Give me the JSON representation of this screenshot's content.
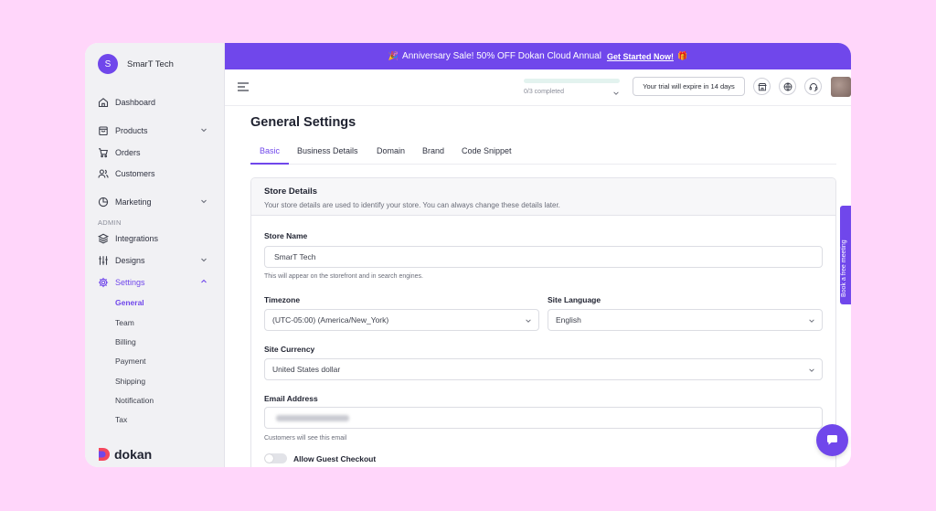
{
  "store": {
    "initial": "S",
    "name": "SmarT Tech"
  },
  "sidebar": {
    "items": [
      {
        "label": "Dashboard",
        "icon": "home-icon"
      },
      {
        "label": "Products",
        "icon": "bag-icon"
      },
      {
        "label": "Orders",
        "icon": "cart-icon"
      },
      {
        "label": "Customers",
        "icon": "users-icon"
      },
      {
        "label": "Marketing",
        "icon": "pie-chart-icon"
      },
      {
        "label": "Integrations",
        "icon": "layers-icon"
      },
      {
        "label": "Designs",
        "icon": "sliders-icon"
      },
      {
        "label": "Settings",
        "icon": "gear-icon"
      }
    ],
    "section_admin": "ADMIN",
    "settings_sub": [
      "General",
      "Team",
      "Billing",
      "Payment",
      "Shipping",
      "Notification",
      "Tax"
    ],
    "logo_text": "dokan"
  },
  "banner": {
    "text": "Anniversary Sale! 50% OFF Dokan Cloud Annual",
    "cta": "Get Started Now!"
  },
  "topbar": {
    "progress_text": "0/3 completed",
    "progress": 0,
    "trial_text": "Your trial will expire in 14 days"
  },
  "page": {
    "title": "General Settings",
    "tabs": [
      "Basic",
      "Business Details",
      "Domain",
      "Brand",
      "Code Snippet"
    ]
  },
  "store_details": {
    "title": "Store Details",
    "description": "Your store details are used to identify your store. You can always change these details later.",
    "store_name_label": "Store Name",
    "store_name_value": "SmarT Tech",
    "store_name_help": "This will appear on the storefront and in search engines.",
    "timezone_label": "Timezone",
    "timezone_value": "(UTC-05:00) (America/New_York)",
    "language_label": "Site Language",
    "language_value": "English",
    "currency_label": "Site Currency",
    "currency_value": "United States dollar",
    "email_label": "Email Address",
    "email_help": "Customers will see this email",
    "guest_checkout_label": "Allow Guest Checkout"
  },
  "side_tab": "Book a free meeting",
  "colors": {
    "accent": "#7047eb",
    "background": "#ffd6fa",
    "sidebar": "#f1f1f4"
  }
}
